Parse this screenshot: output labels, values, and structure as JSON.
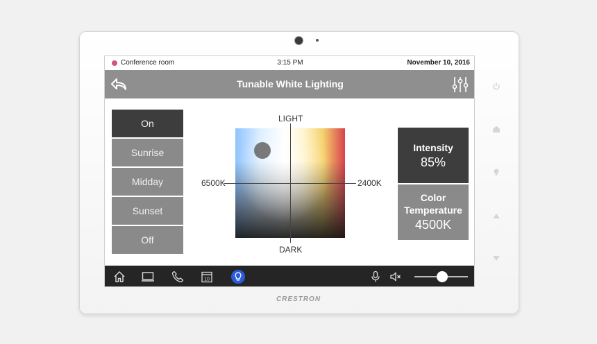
{
  "status": {
    "room": "Conference room",
    "time": "3:15 PM",
    "date": "November 10, 2016",
    "room_dot_color": "#d2557f"
  },
  "header": {
    "title": "Tunable White Lighting",
    "back_icon": "back-arrow-icon",
    "settings_icon": "sliders-icon"
  },
  "presets": {
    "on": "On",
    "sunrise": "Sunrise",
    "midday": "Midday",
    "sunset": "Sunset",
    "off": "Off",
    "selected": "On"
  },
  "color_picker": {
    "top_label": "LIGHT",
    "bottom_label": "DARK",
    "left_label": "6500K",
    "right_label": "2400K"
  },
  "tiles": {
    "intensity": {
      "label": "Intensity",
      "value": "85%"
    },
    "color_temp": {
      "label_line1": "Color",
      "label_line2": "Temperature",
      "value": "4500K"
    }
  },
  "taskbar": {
    "icons": [
      "home-icon",
      "display-icon",
      "phone-icon",
      "calendar-icon",
      "lightbulb-icon",
      "microphone-icon",
      "mute-icon"
    ],
    "calendar_day": "10",
    "active": "lightbulb-icon",
    "accent": "#2a5bdc"
  },
  "device": {
    "brand": "CRESTRON"
  }
}
